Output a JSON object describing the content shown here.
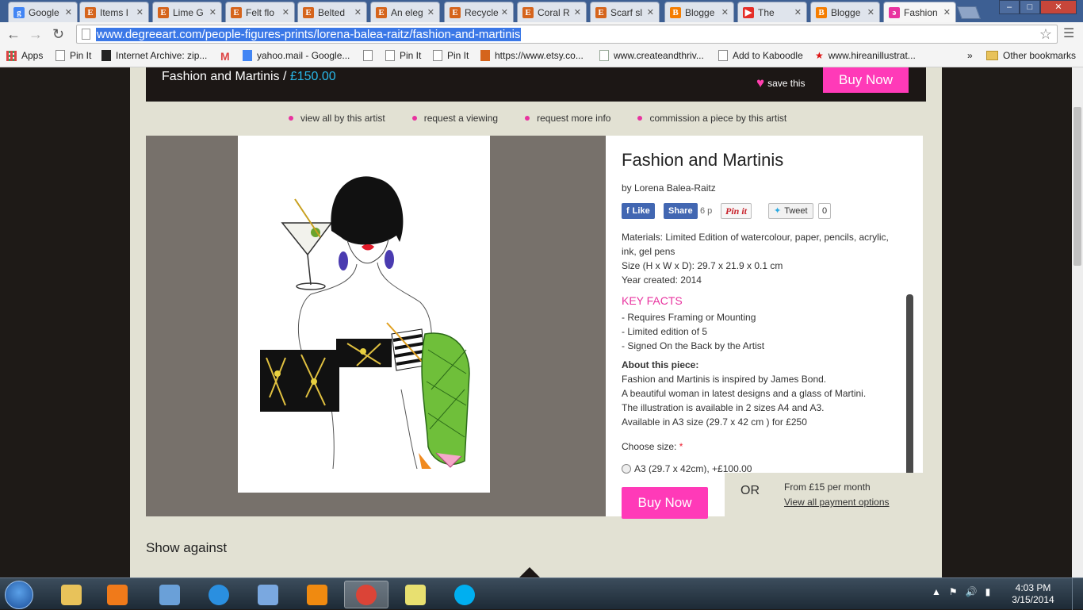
{
  "browser": {
    "tabs": [
      {
        "label": "Google",
        "icon": "google-g-icon",
        "color": "#4285f4",
        "glyph": "g"
      },
      {
        "label": "Items I",
        "icon": "etsy-icon",
        "color": "#d5641c",
        "glyph": "E"
      },
      {
        "label": "Lime G",
        "icon": "etsy-icon",
        "color": "#d5641c",
        "glyph": "E"
      },
      {
        "label": "Felt flo",
        "icon": "etsy-icon",
        "color": "#d5641c",
        "glyph": "E"
      },
      {
        "label": "Belted",
        "icon": "etsy-icon",
        "color": "#d5641c",
        "glyph": "E"
      },
      {
        "label": "An eleg",
        "icon": "etsy-icon",
        "color": "#d5641c",
        "glyph": "E"
      },
      {
        "label": "Recycle",
        "icon": "etsy-icon",
        "color": "#d5641c",
        "glyph": "E"
      },
      {
        "label": "Coral R",
        "icon": "etsy-icon",
        "color": "#d5641c",
        "glyph": "E"
      },
      {
        "label": "Scarf sl",
        "icon": "etsy-icon",
        "color": "#d5641c",
        "glyph": "E"
      },
      {
        "label": "Blogge",
        "icon": "blogger-icon",
        "color": "#f57d00",
        "glyph": "B"
      },
      {
        "label": "The",
        "icon": "youtube-icon",
        "color": "#e52d27",
        "glyph": "▶"
      },
      {
        "label": "Blogge",
        "icon": "blogger-icon",
        "color": "#f57d00",
        "glyph": "B"
      },
      {
        "label": "Fashion",
        "icon": "degreeart-icon",
        "color": "#e8339f",
        "glyph": "ə"
      }
    ],
    "url": "www.degreeart.com/people-figures-prints/lorena-balea-raitz/fashion-and-martinis",
    "bookmarks": [
      {
        "label": "Apps",
        "icon": "apps-grid-icon"
      },
      {
        "label": "Pin It",
        "icon": "page-icon"
      },
      {
        "label": "Internet Archive: zip...",
        "icon": "archive-icon"
      },
      {
        "label": "",
        "icon": "gmail-icon"
      },
      {
        "label": "yahoo.mail - Google...",
        "icon": "google-g-icon"
      },
      {
        "label": "",
        "icon": "page-icon"
      },
      {
        "label": "Pin It",
        "icon": "page-icon"
      },
      {
        "label": "Pin It",
        "icon": "page-icon"
      },
      {
        "label": "https://www.etsy.co...",
        "icon": "etsy-icon"
      },
      {
        "label": "www.createandthriv...",
        "icon": "leaf-icon"
      },
      {
        "label": "Add to Kaboodle",
        "icon": "page-icon"
      },
      {
        "label": "www.hireanillustrat...",
        "icon": "star-icon"
      }
    ],
    "more_bookmarks": "»",
    "other_bookmarks": "Other bookmarks"
  },
  "page": {
    "header_title": "Fashion and Martinis",
    "header_sep": " / ",
    "header_price": "£150.00",
    "save_label": "save this",
    "buy_now": "Buy Now",
    "sub_links": [
      "view all by this artist",
      "request a viewing",
      "request more info",
      "commission a piece by this artist"
    ],
    "title": "Fashion and Martinis",
    "by_line": "by Lorena Balea-Raitz",
    "social": {
      "like": "Like",
      "share": "Share",
      "share_count": "6 p",
      "pin": "Pin it",
      "tweet": "Tweet",
      "tweet_count": "0"
    },
    "materials": "Materials: Limited Edition of watercolour, paper, pencils, acrylic, ink, gel pens",
    "size": "Size (H x W x D): 29.7 x 21.9 x 0.1 cm",
    "year": "Year created: 2014",
    "key_facts_title": "KEY FACTS",
    "key_facts": [
      "- Requires Framing or Mounting",
      "- Limited edition of 5",
      "- Signed On the Back by the Artist"
    ],
    "about_title": "About this piece:",
    "about_lines": [
      "Fashion and Martinis is inspired by James Bond.",
      "A beautiful woman in latest designs and a glass of Martini.",
      "The illustration is available in 2 sizes A4 and A3.",
      "Available in A3 size (29.7 x 42 cm ) for £250"
    ],
    "choose_size": "Choose size:",
    "required_mark": "*",
    "size_option": "A3 (29.7 x 42cm), +£100.00",
    "or_label": "OR",
    "from_label": "From £15 per month",
    "payment_link": "View all payment options",
    "show_against": "Show against"
  },
  "taskbar": {
    "apps": [
      {
        "icon": "file-explorer-icon",
        "color": "#e8c25a"
      },
      {
        "icon": "media-player-icon",
        "color": "#f07a1a"
      },
      {
        "icon": "network-computer-icon",
        "color": "#6aa0d8"
      },
      {
        "icon": "internet-explorer-icon",
        "color": "#2a8fe0"
      },
      {
        "icon": "paint-icon",
        "color": "#7aa8e0"
      },
      {
        "icon": "vlc-icon",
        "color": "#f08a10"
      },
      {
        "icon": "chrome-icon",
        "color": "#db4437"
      },
      {
        "icon": "sticky-notes-icon",
        "color": "#e8e070"
      },
      {
        "icon": "skype-icon",
        "color": "#00aff0"
      }
    ],
    "time": "4:03 PM",
    "date": "3/15/2014"
  }
}
